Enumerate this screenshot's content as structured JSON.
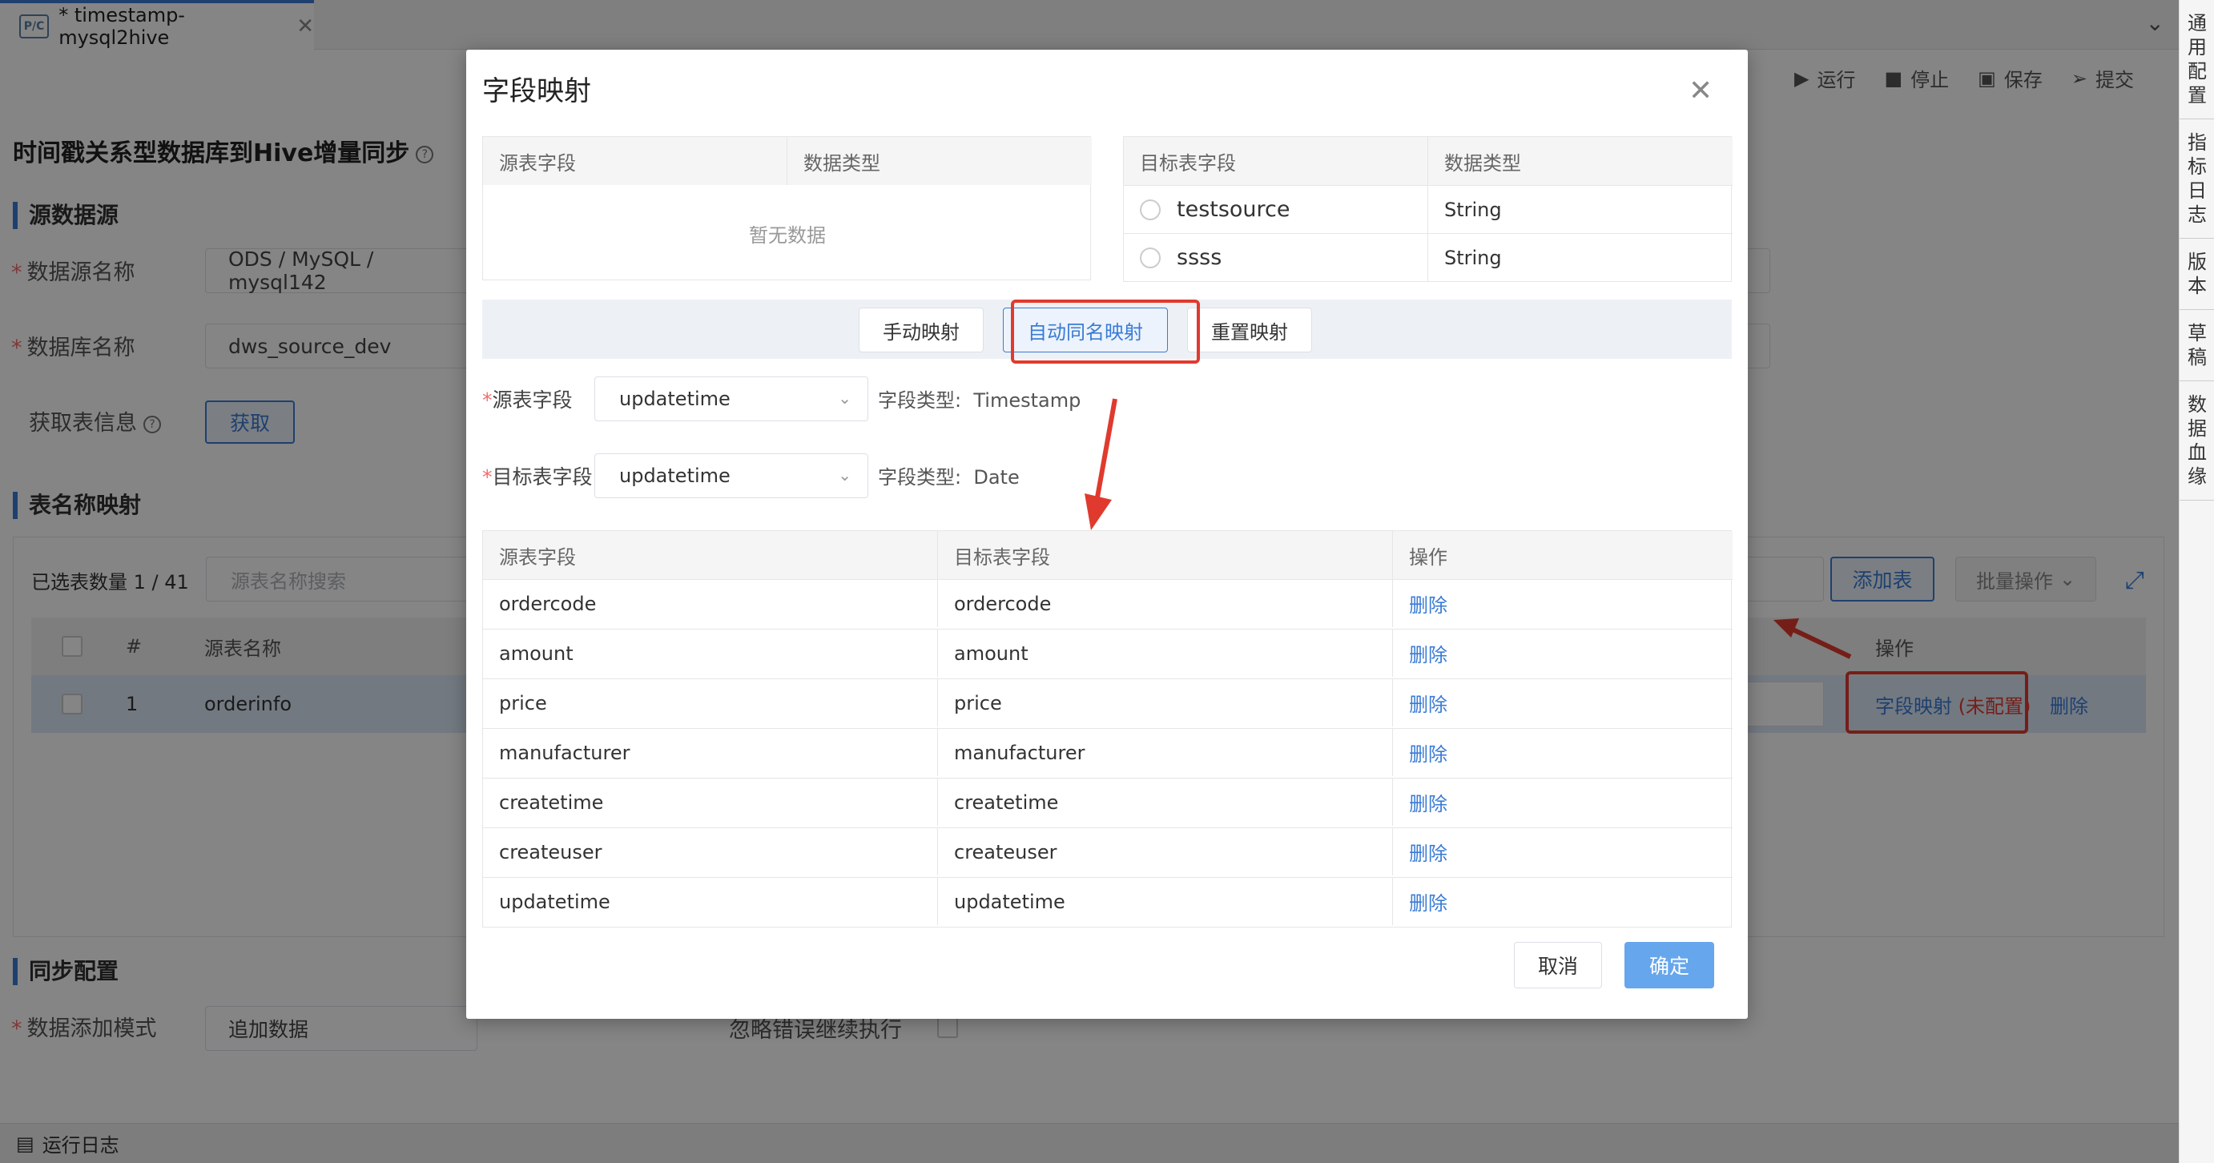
{
  "tab": {
    "title": "* timestamp-mysql2hive",
    "file_icon": "P/C"
  },
  "right_sidebar": [
    "通用配置",
    "指标日志",
    "版本",
    "草稿",
    "数据血缘"
  ],
  "toolbar": {
    "run": "运行",
    "stop": "停止",
    "save": "保存",
    "submit": "提交"
  },
  "page": {
    "title": "时间戳关系型数据库到Hive增量同步",
    "section_source": "源数据源",
    "datasource_label": "数据源名称",
    "datasource_value": "ODS / MySQL / mysql142",
    "database_label": "数据库名称",
    "database_value": "dws_source_dev",
    "fetch_label": "获取表信息",
    "fetch_button": "获取",
    "section_mapping": "表名称映射",
    "selected_count": "已选表数量 1 / 41",
    "search_placeholder": "源表名称搜索",
    "add_table": "添加表",
    "batch_ops": "批量操作",
    "table_headers": {
      "index": "#",
      "source_name": "源表名称",
      "ops": "操作"
    },
    "row": {
      "index": "1",
      "source_name": "orderinfo",
      "field_mapping": "字段映射",
      "unconfigured": "(未配置)",
      "delete": "删除"
    },
    "section_sync": "同步配置",
    "append_mode_label": "数据添加模式",
    "append_mode_value": "追加数据",
    "ignore_error_label": "忽略错误继续执行"
  },
  "status_bar": {
    "log": "运行日志"
  },
  "modal": {
    "title": "字段映射",
    "source_table": {
      "headers": [
        "源表字段",
        "数据类型"
      ],
      "empty": "暂无数据"
    },
    "target_table": {
      "headers": [
        "目标表字段",
        "数据类型"
      ],
      "rows": [
        {
          "name": "testsource",
          "type": "String"
        },
        {
          "name": "ssss",
          "type": "String"
        }
      ]
    },
    "buttons": {
      "manual": "手动映射",
      "auto_same_name": "自动同名映射",
      "reset": "重置映射"
    },
    "source_field_label": "源表字段",
    "source_field_value": "updatetime",
    "source_field_type_label": "字段类型:",
    "source_field_type": "Timestamp",
    "target_field_label": "目标表字段",
    "target_field_value": "updatetime",
    "target_field_type_label": "字段类型:",
    "target_field_type": "Date",
    "map_headers": [
      "源表字段",
      "目标表字段",
      "操作"
    ],
    "map_rows": [
      {
        "src": "ordercode",
        "dst": "ordercode",
        "op": "删除"
      },
      {
        "src": "amount",
        "dst": "amount",
        "op": "删除"
      },
      {
        "src": "price",
        "dst": "price",
        "op": "删除"
      },
      {
        "src": "manufacturer",
        "dst": "manufacturer",
        "op": "删除"
      },
      {
        "src": "createtime",
        "dst": "createtime",
        "op": "删除"
      },
      {
        "src": "createuser",
        "dst": "createuser",
        "op": "删除"
      },
      {
        "src": "updatetime",
        "dst": "updatetime",
        "op": "删除"
      }
    ],
    "cancel": "取消",
    "confirm": "确定"
  },
  "colors": {
    "accent": "#3a7bd5",
    "highlight": "#e03a2e",
    "required": "#f56c6c"
  }
}
